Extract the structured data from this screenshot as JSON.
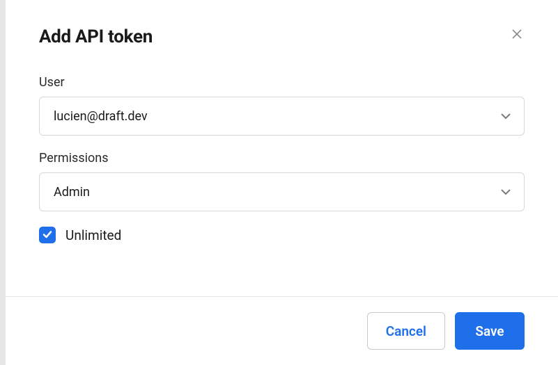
{
  "modal": {
    "title": "Add API token",
    "fields": {
      "user": {
        "label": "User",
        "value": "lucien@draft.dev"
      },
      "permissions": {
        "label": "Permissions",
        "value": "Admin"
      },
      "unlimited": {
        "label": "Unlimited",
        "checked": true
      }
    },
    "actions": {
      "cancel": "Cancel",
      "save": "Save"
    }
  }
}
